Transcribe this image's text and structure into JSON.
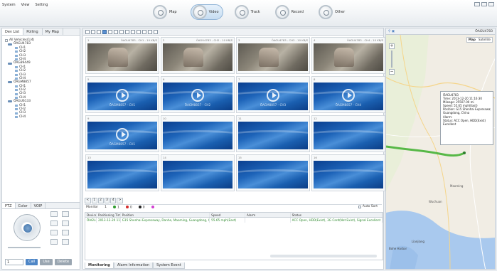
{
  "menu": [
    "System",
    "View",
    "Setting"
  ],
  "modes": [
    {
      "label": "Map",
      "active": false
    },
    {
      "label": "Video",
      "active": true
    },
    {
      "label": "Track",
      "active": false
    },
    {
      "label": "Record",
      "active": false
    },
    {
      "label": "Other",
      "active": false
    }
  ],
  "left": {
    "tabs": [
      "Dev List",
      "Polling",
      "My Map"
    ],
    "tree": [
      {
        "type": "root",
        "label": "All Vehicles(1/4)"
      },
      {
        "type": "veh",
        "label": "ÖAGU4783"
      },
      {
        "type": "ch",
        "label": "CH1"
      },
      {
        "type": "ch",
        "label": "CH2"
      },
      {
        "type": "ch",
        "label": "CH3"
      },
      {
        "type": "ch",
        "label": "CH4"
      },
      {
        "type": "veh",
        "label": "ÖAG89449"
      },
      {
        "type": "ch",
        "label": "CH1"
      },
      {
        "type": "ch",
        "label": "CH2"
      },
      {
        "type": "ch",
        "label": "CH3"
      },
      {
        "type": "ch",
        "label": "CH4"
      },
      {
        "type": "veh",
        "label": "ÖAGM8857"
      },
      {
        "type": "ch",
        "label": "CH1"
      },
      {
        "type": "ch",
        "label": "CH2"
      },
      {
        "type": "ch",
        "label": "CH3"
      },
      {
        "type": "ch",
        "label": "CH4"
      },
      {
        "type": "veh",
        "label": "ÖAGU6133"
      },
      {
        "type": "ch",
        "label": "CH1"
      },
      {
        "type": "ch",
        "label": "CH2"
      },
      {
        "type": "ch",
        "label": "CH3"
      },
      {
        "type": "ch",
        "label": "CH4"
      }
    ],
    "ptz_tabs": [
      "PTZ",
      "Color",
      "VOIP"
    ],
    "ptz_value": "1",
    "ptz_buttons": [
      "Call",
      "Use",
      "Delete"
    ]
  },
  "video": {
    "cells": [
      {
        "num": "1",
        "caption": "ÖAGU4783 - CH1 - 10 KB/S",
        "live": true,
        "overlay": ""
      },
      {
        "num": "2",
        "caption": "ÖAGU4783 - CH2 - 10 KB/S",
        "live": true,
        "overlay": ""
      },
      {
        "num": "3",
        "caption": "ÖAGU4783 - CH3 - 10 KB/S",
        "live": true,
        "overlay": ""
      },
      {
        "num": "4",
        "caption": "ÖAGU4783 - CH4 - 10 KB/S",
        "live": true,
        "overlay": ""
      },
      {
        "num": "5",
        "caption": "",
        "live": false,
        "play": true,
        "overlay": "ÖAGM8857 - CH1"
      },
      {
        "num": "6",
        "caption": "",
        "live": false,
        "play": true,
        "overlay": "ÖAGM8857 - CH2"
      },
      {
        "num": "7",
        "caption": "",
        "live": false,
        "play": true,
        "overlay": "ÖAGM8857 - CH3"
      },
      {
        "num": "8",
        "caption": "",
        "live": false,
        "play": true,
        "overlay": "ÖAGM8857 - CH4"
      },
      {
        "num": "9",
        "caption": "",
        "live": false,
        "play": true,
        "overlay": "ÖAGM8857 - CH1"
      },
      {
        "num": "10",
        "caption": "",
        "live": false,
        "play": false,
        "overlay": ""
      },
      {
        "num": "11",
        "caption": "",
        "live": false,
        "play": false,
        "overlay": ""
      },
      {
        "num": "12",
        "caption": "",
        "live": false,
        "play": false,
        "overlay": ""
      },
      {
        "num": "13",
        "caption": "",
        "live": false,
        "play": false,
        "overlay": ""
      },
      {
        "num": "14",
        "caption": "",
        "live": false,
        "play": false,
        "overlay": ""
      },
      {
        "num": "15",
        "caption": "",
        "live": false,
        "play": false,
        "overlay": ""
      },
      {
        "num": "16",
        "caption": "",
        "live": false,
        "play": false,
        "overlay": ""
      }
    ],
    "pages": [
      "<",
      "1",
      "2",
      "3",
      "4",
      ">"
    ]
  },
  "monitor": {
    "label": "Monitor",
    "count_all": "1",
    "counts": [
      {
        "value": "1",
        "color": "#2e9b2e"
      },
      {
        "value": "0",
        "color": "#d42a2a"
      },
      {
        "value": "0",
        "color": "#222222"
      },
      {
        "value": "",
        "color": "#d23fd2"
      }
    ],
    "auto_sort": "Auto Sort",
    "columns": [
      "Device",
      "Positioning Time",
      "Position",
      "Speed",
      "Alarm",
      "Status"
    ],
    "rows": [
      {
        "device": "ÖAGU4783",
        "time": "2013-12-20 11:16:30",
        "position": "G15 Shenhai Expressway, Danhe, Maoming, Guangdong, CN",
        "speed": "55.65 mph(East)",
        "alarm": "",
        "status": "ACC Open, HDD(Exist), 3G Card(Not Exist), Signal Excellent"
      }
    ],
    "bottom_tabs": [
      "Monitoring",
      "Alarm Information",
      "System Event"
    ]
  },
  "map": {
    "vehicle": "ÖAGU4783",
    "types": [
      "Map",
      "Satellite"
    ],
    "info": [
      "ÖAGU4783",
      "Time: 2013-12-20 11:16:30",
      "Mileage: 25507.00 mi",
      "Speed: 55.65 mph(East)",
      "Position: G15 Shenhai Expressway",
      "Guangdong, China",
      "Alarm:",
      "Status: ACC Open, HDD(Exist)",
      "Excellent"
    ],
    "labels": [
      "Maoming",
      "Wuchuan",
      "Bohe Harbor",
      "Lianjiang"
    ],
    "accent": "#57b847"
  }
}
